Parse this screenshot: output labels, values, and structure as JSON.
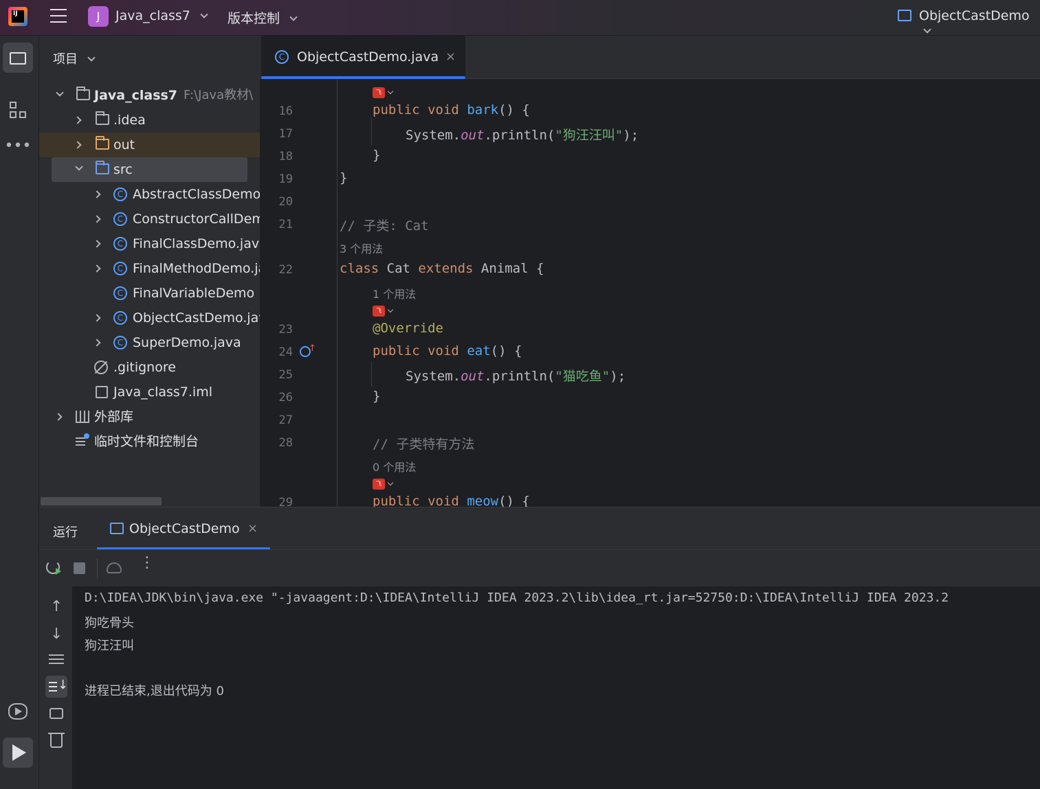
{
  "titlebar": {
    "project_badge": "J",
    "project_name": "Java_class7",
    "vcs_label": "版本控制",
    "run_config": "ObjectCastDemo"
  },
  "project_panel": {
    "title": "项目",
    "root": {
      "name": "Java_class7",
      "path": "F:\\Java教材\\"
    },
    "items": [
      {
        "label": ".idea"
      },
      {
        "label": "out"
      },
      {
        "label": "src"
      },
      {
        "label": "AbstractClassDemo.java"
      },
      {
        "label": "ConstructorCallDemo.java"
      },
      {
        "label": "FinalClassDemo.java"
      },
      {
        "label": "FinalMethodDemo.java"
      },
      {
        "label": "FinalVariableDemo"
      },
      {
        "label": "ObjectCastDemo.java"
      },
      {
        "label": "SuperDemo.java"
      },
      {
        "label": ".gitignore"
      },
      {
        "label": "Java_class7.iml"
      },
      {
        "label": "外部库"
      },
      {
        "label": "临时文件和控制台"
      }
    ]
  },
  "editor": {
    "tab_label": "ObjectCastDemo.java",
    "tab_close": "×",
    "line_numbers": [
      "16",
      "17",
      "18",
      "19",
      "20",
      "21",
      "22",
      "23",
      "24",
      "25",
      "26",
      "27",
      "28",
      "29"
    ],
    "hints": [
      "3 个用法",
      "1 个用法",
      "0 个用法"
    ],
    "code": {
      "l16_kw1": "public",
      "l16_kw2": "void",
      "l16_fn": "bark",
      "l16_rest": "() {",
      "l17_a": "System.",
      "l17_out": "out",
      "l17_b": ".println(",
      "l17_str": "\"狗汪汪叫\"",
      "l17_c": ");",
      "l18": "}",
      "l19": "}",
      "l21_cmt": "// 子类: Cat",
      "l22_kw1": "class",
      "l22_name": " Cat ",
      "l22_kw2": "extends",
      "l22_rest": " Animal {",
      "l23_ann": "@Override",
      "l24_kw1": "public",
      "l24_kw2": "void",
      "l24_fn": "eat",
      "l24_rest": "() {",
      "l25_a": "System.",
      "l25_out": "out",
      "l25_b": ".println(",
      "l25_str": "\"猫吃鱼\"",
      "l25_c": ");",
      "l26": "}",
      "l28_cmt": "// 子类特有方法",
      "l29_kw1": "public",
      "l29_kw2": "void",
      "l29_fn": "meow",
      "l29_rest": "() {"
    }
  },
  "run_panel": {
    "title": "运行",
    "tab_label": "ObjectCastDemo",
    "tab_close": "×",
    "console": [
      "D:\\IDEA\\JDK\\bin\\java.exe \"-javaagent:D:\\IDEA\\IntelliJ IDEA 2023.2\\lib\\idea_rt.jar=52750:D:\\IDEA\\IntelliJ IDEA 2023.2",
      "狗吃骨头",
      "狗汪汪叫",
      "",
      "进程已结束,退出代码为 0"
    ]
  },
  "colors": {
    "accent": "#3574f0",
    "keyword": "#cf8e6d",
    "function": "#56a8f5",
    "string": "#6aab73",
    "annotation": "#b3ae60"
  }
}
